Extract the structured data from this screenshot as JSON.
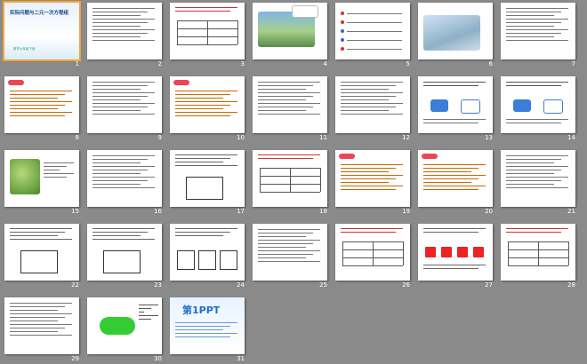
{
  "slides": [
    {
      "n": "1",
      "title": "实际问题与二元一次方程组",
      "subtitle": "数学七年级下册",
      "kind": "title"
    },
    {
      "n": "2",
      "kind": "text"
    },
    {
      "n": "3",
      "kind": "table"
    },
    {
      "n": "4",
      "kind": "photo"
    },
    {
      "n": "5",
      "kind": "list"
    },
    {
      "n": "6",
      "kind": "photo2"
    },
    {
      "n": "7",
      "kind": "text"
    },
    {
      "n": "8",
      "kind": "text-red"
    },
    {
      "n": "9",
      "kind": "text"
    },
    {
      "n": "10",
      "kind": "text-red"
    },
    {
      "n": "11",
      "kind": "text"
    },
    {
      "n": "12",
      "kind": "text"
    },
    {
      "n": "13",
      "kind": "diagram"
    },
    {
      "n": "14",
      "kind": "diagram"
    },
    {
      "n": "15",
      "kind": "photo-flower"
    },
    {
      "n": "16",
      "kind": "text"
    },
    {
      "n": "17",
      "kind": "rect"
    },
    {
      "n": "18",
      "kind": "table"
    },
    {
      "n": "19",
      "kind": "text-red"
    },
    {
      "n": "20",
      "kind": "text-red"
    },
    {
      "n": "21",
      "kind": "text"
    },
    {
      "n": "22",
      "kind": "rect"
    },
    {
      "n": "23",
      "kind": "rect"
    },
    {
      "n": "24",
      "kind": "grid"
    },
    {
      "n": "25",
      "kind": "text"
    },
    {
      "n": "26",
      "kind": "table"
    },
    {
      "n": "27",
      "kind": "crosses"
    },
    {
      "n": "28",
      "kind": "table"
    },
    {
      "n": "29",
      "kind": "text"
    },
    {
      "n": "30",
      "kind": "arrow"
    },
    {
      "n": "31",
      "kind": "brand",
      "brand": "第1PPT"
    }
  ]
}
